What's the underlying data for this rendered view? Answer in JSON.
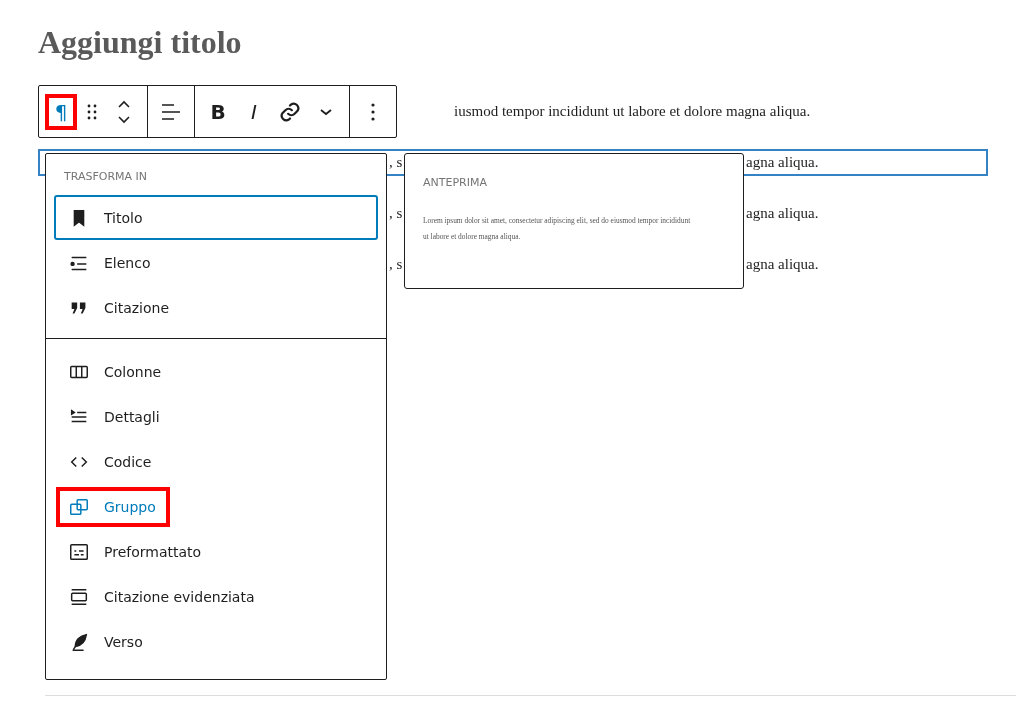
{
  "title": "Aggiungi titolo",
  "toolbar": {
    "block_symbol": "¶",
    "block_annotated": true,
    "bold": "B",
    "italic": "I"
  },
  "paragraphs": [
    {
      "selected": false,
      "pieces": [
        {
          "kind": "after-toolbar",
          "text": "iusmod tempor incididunt ut labore et dolore magna aliqua."
        }
      ]
    },
    {
      "selected": true,
      "pieces": [
        {
          "kind": "between-panels",
          "text": ", s"
        },
        {
          "kind": "after-preview",
          "text": "agna aliqua."
        }
      ]
    },
    {
      "selected": false,
      "pieces": [
        {
          "kind": "between-panels",
          "text": ", s"
        },
        {
          "kind": "after-preview",
          "text": "agna aliqua."
        }
      ]
    },
    {
      "selected": false,
      "pieces": [
        {
          "kind": "between-panels",
          "text": ", s"
        },
        {
          "kind": "after-preview",
          "text": "agna aliqua."
        }
      ]
    }
  ],
  "transform_menu": {
    "heading": "TRASFORMA IN",
    "groups": [
      [
        {
          "label": "Titolo",
          "focused": true,
          "hovered": false,
          "annotated": false
        },
        {
          "label": "Elenco",
          "focused": false,
          "hovered": false,
          "annotated": false
        },
        {
          "label": "Citazione",
          "focused": false,
          "hovered": false,
          "annotated": false
        }
      ],
      [
        {
          "label": "Colonne",
          "focused": false,
          "hovered": false,
          "annotated": false
        },
        {
          "label": "Dettagli",
          "focused": false,
          "hovered": false,
          "annotated": false
        },
        {
          "label": "Codice",
          "focused": false,
          "hovered": false,
          "annotated": false
        },
        {
          "label": "Gruppo",
          "focused": false,
          "hovered": true,
          "annotated": true
        },
        {
          "label": "Preformattato",
          "focused": false,
          "hovered": false,
          "annotated": false
        },
        {
          "label": "Citazione evidenziata",
          "focused": false,
          "hovered": false,
          "annotated": false
        },
        {
          "label": "Verso",
          "focused": false,
          "hovered": false,
          "annotated": false
        }
      ]
    ]
  },
  "preview": {
    "heading": "ANTEPRIMA",
    "text": "Lorem ipsum dolor sit amet, consectetur adipiscing elit, sed do eiusmod tempor incididunt ut labore et dolore magna aliqua."
  }
}
